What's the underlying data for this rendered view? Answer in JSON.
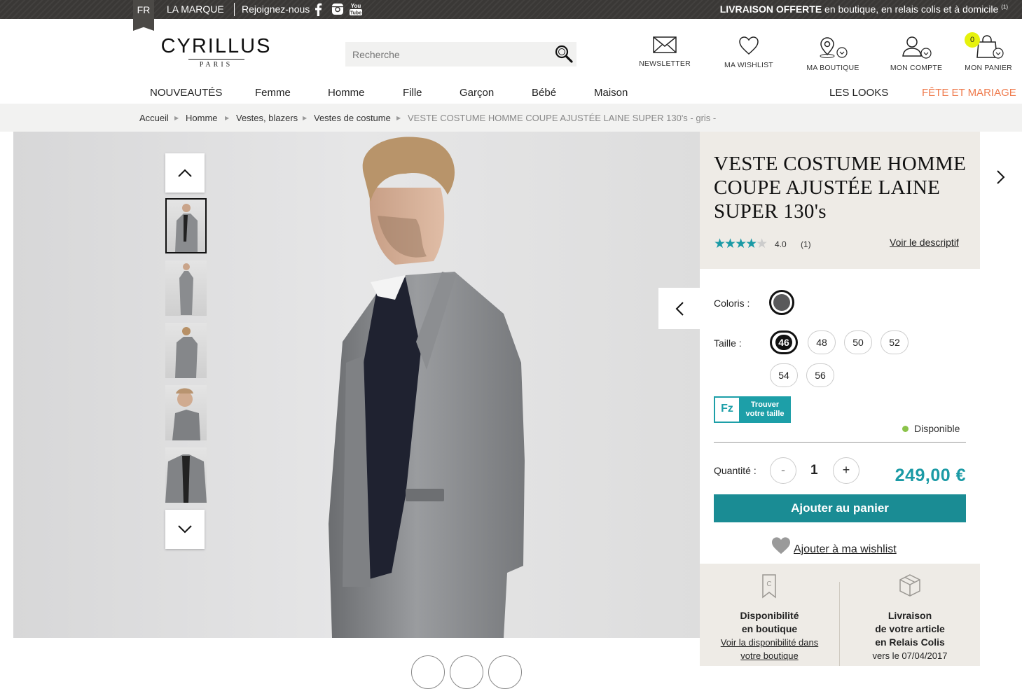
{
  "topbar": {
    "lang": "FR",
    "marque": "LA MARQUE",
    "join": "Rejoignez-nous",
    "social": [
      "facebook-icon",
      "instagram-icon",
      "youtube-icon"
    ],
    "youtube_text": "You",
    "youtube_text2": "Tube",
    "promo_bold": "LIVRAISON OFFERTE",
    "promo_rest": " en boutique, en relais colis et à domicile",
    "promo_sup": "(1)"
  },
  "logo": {
    "name": "CYRILLUS",
    "sub": "PARIS"
  },
  "search": {
    "placeholder": "Recherche"
  },
  "header_icons": {
    "newsletter": "NEWSLETTER",
    "wishlist": "MA WISHLIST",
    "store": "MA BOUTIQUE",
    "account": "MON COMPTE",
    "cart": "MON PANIER",
    "cart_count": "0"
  },
  "nav": {
    "items": [
      "NOUVEAUTÉS",
      "Femme",
      "Homme",
      "Fille",
      "Garçon",
      "Bébé",
      "Maison"
    ],
    "looks": "LES LOOKS",
    "wedding": "FÊTE ET MARIAGE"
  },
  "breadcrumb": [
    "Accueil",
    "Homme",
    "Vestes, blazers",
    "Vestes de costume",
    "VESTE COSTUME HOMME COUPE AJUSTÉE LAINE SUPER 130's - gris -"
  ],
  "product": {
    "title": "VESTE COSTUME HOMME COUPE AJUSTÉE LAINE SUPER 130's",
    "rating": "4.0",
    "rating_value": 4,
    "rating_max": 5,
    "reviews": "(1)",
    "voir": "Voir le descriptif",
    "coloris_label": "Coloris :",
    "taille_label": "Taille :",
    "sizes": [
      "46",
      "48",
      "50",
      "52",
      "54",
      "56"
    ],
    "selected_size": "46",
    "fitz_logo": "Fz",
    "fitz_line1": "Trouver",
    "fitz_line2": "votre taille",
    "dispo": "Disponible",
    "qty_label": "Quantité :",
    "qty_minus": "-",
    "qty": "1",
    "qty_plus": "+",
    "price": "249,00 €",
    "add": "Ajouter au panier",
    "wish": "Ajouter à ma wishlist"
  },
  "services": {
    "store_t1": "Disponibilité",
    "store_t2": "en boutique",
    "store_l1": "Voir la disponibilité dans",
    "store_l2": "votre boutique",
    "del_t1": "Livraison",
    "del_t2": "de votre article",
    "del_t3": "en Relais Colis",
    "del_d": "vers le 07/04/2017"
  },
  "colors": {
    "accent": "#1a9aa5",
    "button": "#1a8c94",
    "wedding": "#ef7b4d",
    "available": "#8bc34a"
  }
}
